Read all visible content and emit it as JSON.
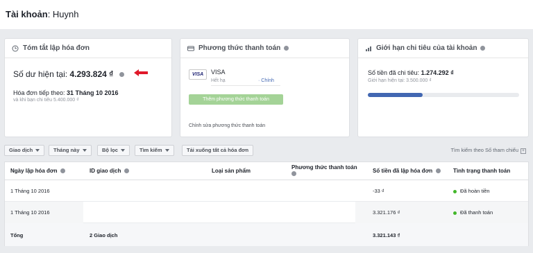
{
  "account": {
    "label": "Tài khoản",
    "name": "Huynh"
  },
  "summary": {
    "title": "Tóm tắt lập hóa đơn",
    "balance_label": "Số dư hiện tại:",
    "balance_value": "4.293.824 ₫",
    "next_label": "Hóa đơn tiếp theo:",
    "next_date": "31 Tháng 10 2016",
    "next_sub": "và khi bạn chi tiêu 5.400.000 ₫"
  },
  "payment": {
    "title": "Phương thức thanh toán",
    "card_brand": "VISA",
    "card_name": "VISA",
    "card_expiry": "Hết hạ",
    "card_main": "· Chính",
    "add_button": "Thêm phương thức thanh toán",
    "edit_link": "Chỉnh sửa phương thức thanh toán"
  },
  "limit": {
    "title": "Giới hạn chi tiêu của tài khoản",
    "spent_label": "Số tiền đã chi tiêu:",
    "spent_value": "1.274.292 ₫",
    "limit_text": "Giới hạn hiện tại: 3.500.000 ₫",
    "progress": 0.364
  },
  "toolbar": {
    "transactions": "Giao dịch",
    "this_month": "Tháng này",
    "filter": "Bộ lọc",
    "search": "Tìm kiếm",
    "download": "Tải xuống tất cả hóa đơn",
    "ref_search": "Tìm kiếm theo Số tham chiếu"
  },
  "table": {
    "headers": {
      "date": "Ngày lập hóa đơn",
      "id": "ID giao dịch",
      "product": "Loại sản phẩm",
      "method": "Phương thức thanh toán",
      "amount": "Số tiền đã lập hóa đơn",
      "status": "Tình trạng thanh toán"
    },
    "rows": [
      {
        "date": "1 Tháng 10 2016",
        "amount": "-33 ₫",
        "status": "Đã hoàn tiền"
      },
      {
        "date": "1 Tháng 10 2016",
        "amount": "3.321.176 ₫",
        "status": "Đã thanh toán"
      }
    ],
    "footer": {
      "label": "Tổng",
      "count": "2 Giao dịch",
      "total": "3.321.143 ₫"
    }
  },
  "colors": {
    "accent": "#4267b2",
    "add_button": "#a4d397",
    "arrow": "#e0192a",
    "status_green": "#42b72a"
  }
}
